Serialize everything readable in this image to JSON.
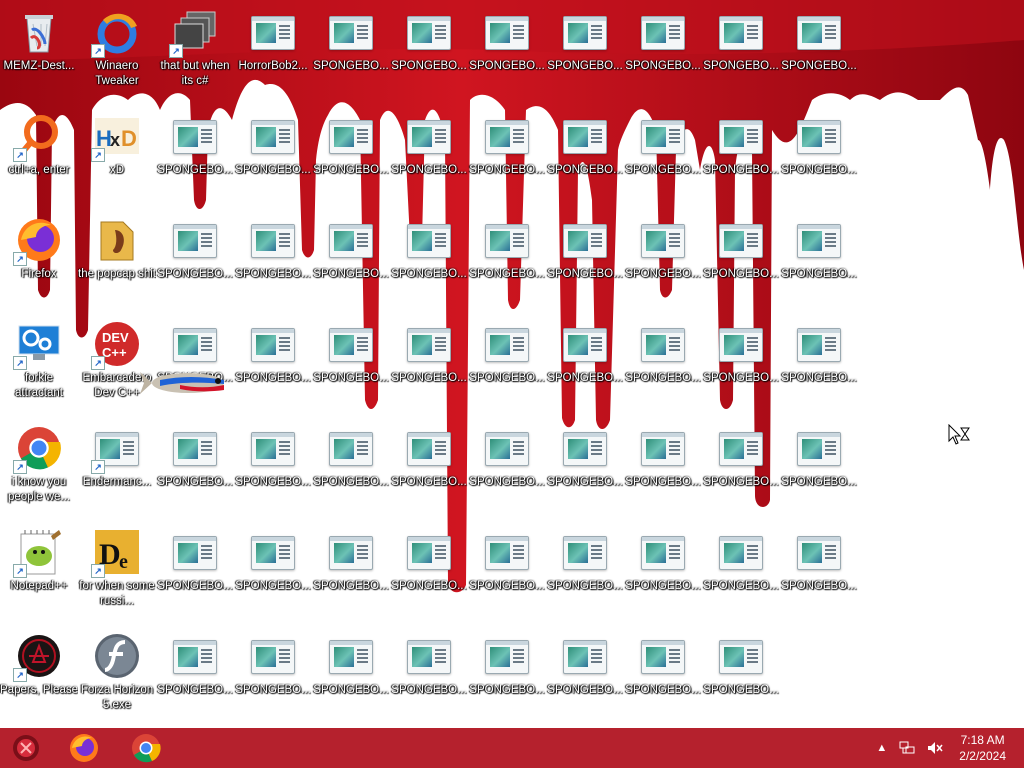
{
  "desktop": {
    "system_icons": [
      {
        "label": "MEMZ-Dest...",
        "icon": "recycle-bin-icon"
      },
      {
        "label": "Winaero Tweaker",
        "icon": "winaero-tweaker-icon"
      },
      {
        "label": "that but when its c#",
        "icon": "window-stack-icon"
      },
      {
        "label": "ctrl+a, enter",
        "icon": "magnifier-ring-icon"
      },
      {
        "label": "xD",
        "icon": "hxd-icon"
      },
      {
        "label": "Firefox",
        "icon": "firefox-icon"
      },
      {
        "label": "the popcap shit",
        "icon": "popcap-folder-icon"
      },
      {
        "label": "forkie attractant",
        "icon": "monitor-gear-icon"
      },
      {
        "label": "Embarcadero Dev C++",
        "icon": "devcpp-icon"
      },
      {
        "label": "i know you people we...",
        "icon": "chrome-icon"
      },
      {
        "label": "Endermanc...",
        "icon": "document-icon"
      },
      {
        "label": "Notepad++",
        "icon": "notepadpp-icon"
      },
      {
        "label": "for when some russi...",
        "icon": "de-icon"
      },
      {
        "label": "Papers, Please",
        "icon": "papers-please-icon"
      },
      {
        "label": "Forza Horizon 5.exe",
        "icon": "flash-icon"
      }
    ],
    "horror_label": "HorrorBob2...",
    "sponge_label": "SPONGEBO..."
  },
  "taskbar": {
    "pinned": [
      {
        "name": "start-button",
        "icon": "start-orb-icon"
      },
      {
        "name": "taskbar-firefox",
        "icon": "firefox-icon"
      },
      {
        "name": "taskbar-chrome",
        "icon": "chrome-icon"
      }
    ],
    "tray": {
      "time": "7:18 AM",
      "date": "2/2/2024",
      "icons": [
        "chevron-up-icon",
        "network-icon",
        "volume-muted-icon"
      ]
    }
  },
  "colors": {
    "taskbar": "#b5212d",
    "blood": "#c8101a",
    "label_text": "#ffffff"
  }
}
